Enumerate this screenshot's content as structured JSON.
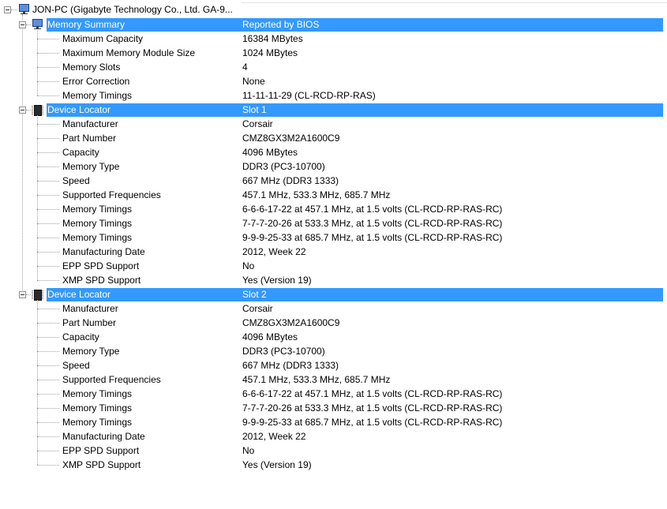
{
  "root": {
    "title": "JON-PC (Gigabyte Technology Co., Ltd. GA-9..."
  },
  "memory_summary": {
    "label": "Memory Summary",
    "value": "Reported by BIOS",
    "items": [
      {
        "label": "Maximum Capacity",
        "value": "16384 MBytes"
      },
      {
        "label": "Maximum Memory Module Size",
        "value": "1024 MBytes"
      },
      {
        "label": "Memory Slots",
        "value": "4"
      },
      {
        "label": "Error Correction",
        "value": "None"
      },
      {
        "label": "Memory Timings",
        "value": "11-11-11-29 (CL-RCD-RP-RAS)"
      }
    ]
  },
  "slots": [
    {
      "label": "Device Locator",
      "value": "Slot 1",
      "items": [
        {
          "label": "Manufacturer",
          "value": "Corsair"
        },
        {
          "label": "Part Number",
          "value": "CMZ8GX3M2A1600C9"
        },
        {
          "label": "Capacity",
          "value": "4096 MBytes"
        },
        {
          "label": "Memory Type",
          "value": "DDR3 (PC3-10700)"
        },
        {
          "label": "Speed",
          "value": "667 MHz (DDR3 1333)"
        },
        {
          "label": "Supported Frequencies",
          "value": "457.1 MHz, 533.3 MHz, 685.7 MHz"
        },
        {
          "label": "Memory Timings",
          "value": "6-6-6-17-22 at 457.1 MHz, at 1.5 volts (CL-RCD-RP-RAS-RC)"
        },
        {
          "label": "Memory Timings",
          "value": "7-7-7-20-26 at 533.3 MHz, at 1.5 volts (CL-RCD-RP-RAS-RC)"
        },
        {
          "label": "Memory Timings",
          "value": "9-9-9-25-33 at 685.7 MHz, at 1.5 volts (CL-RCD-RP-RAS-RC)"
        },
        {
          "label": "Manufacturing Date",
          "value": "2012, Week 22"
        },
        {
          "label": "EPP SPD Support",
          "value": "No"
        },
        {
          "label": "XMP SPD Support",
          "value": "Yes (Version 19)"
        }
      ]
    },
    {
      "label": "Device Locator",
      "value": "Slot 2",
      "items": [
        {
          "label": "Manufacturer",
          "value": "Corsair"
        },
        {
          "label": "Part Number",
          "value": "CMZ8GX3M2A1600C9"
        },
        {
          "label": "Capacity",
          "value": "4096 MBytes"
        },
        {
          "label": "Memory Type",
          "value": "DDR3 (PC3-10700)"
        },
        {
          "label": "Speed",
          "value": "667 MHz (DDR3 1333)"
        },
        {
          "label": "Supported Frequencies",
          "value": "457.1 MHz, 533.3 MHz, 685.7 MHz"
        },
        {
          "label": "Memory Timings",
          "value": "6-6-6-17-22 at 457.1 MHz, at 1.5 volts (CL-RCD-RP-RAS-RC)"
        },
        {
          "label": "Memory Timings",
          "value": "7-7-7-20-26 at 533.3 MHz, at 1.5 volts (CL-RCD-RP-RAS-RC)"
        },
        {
          "label": "Memory Timings",
          "value": "9-9-9-25-33 at 685.7 MHz, at 1.5 volts (CL-RCD-RP-RAS-RC)"
        },
        {
          "label": "Manufacturing Date",
          "value": "2012, Week 22"
        },
        {
          "label": "EPP SPD Support",
          "value": "No"
        },
        {
          "label": "XMP SPD Support",
          "value": "Yes (Version 19)"
        }
      ]
    }
  ],
  "colors": {
    "selection": "#3399ff",
    "selection_text": "#ffffff",
    "tree_lines": "#a0a0a0"
  },
  "icons": {
    "root": "computer-icon",
    "memory_summary": "computer-icon",
    "device_locator": "memory-chip-icon"
  }
}
